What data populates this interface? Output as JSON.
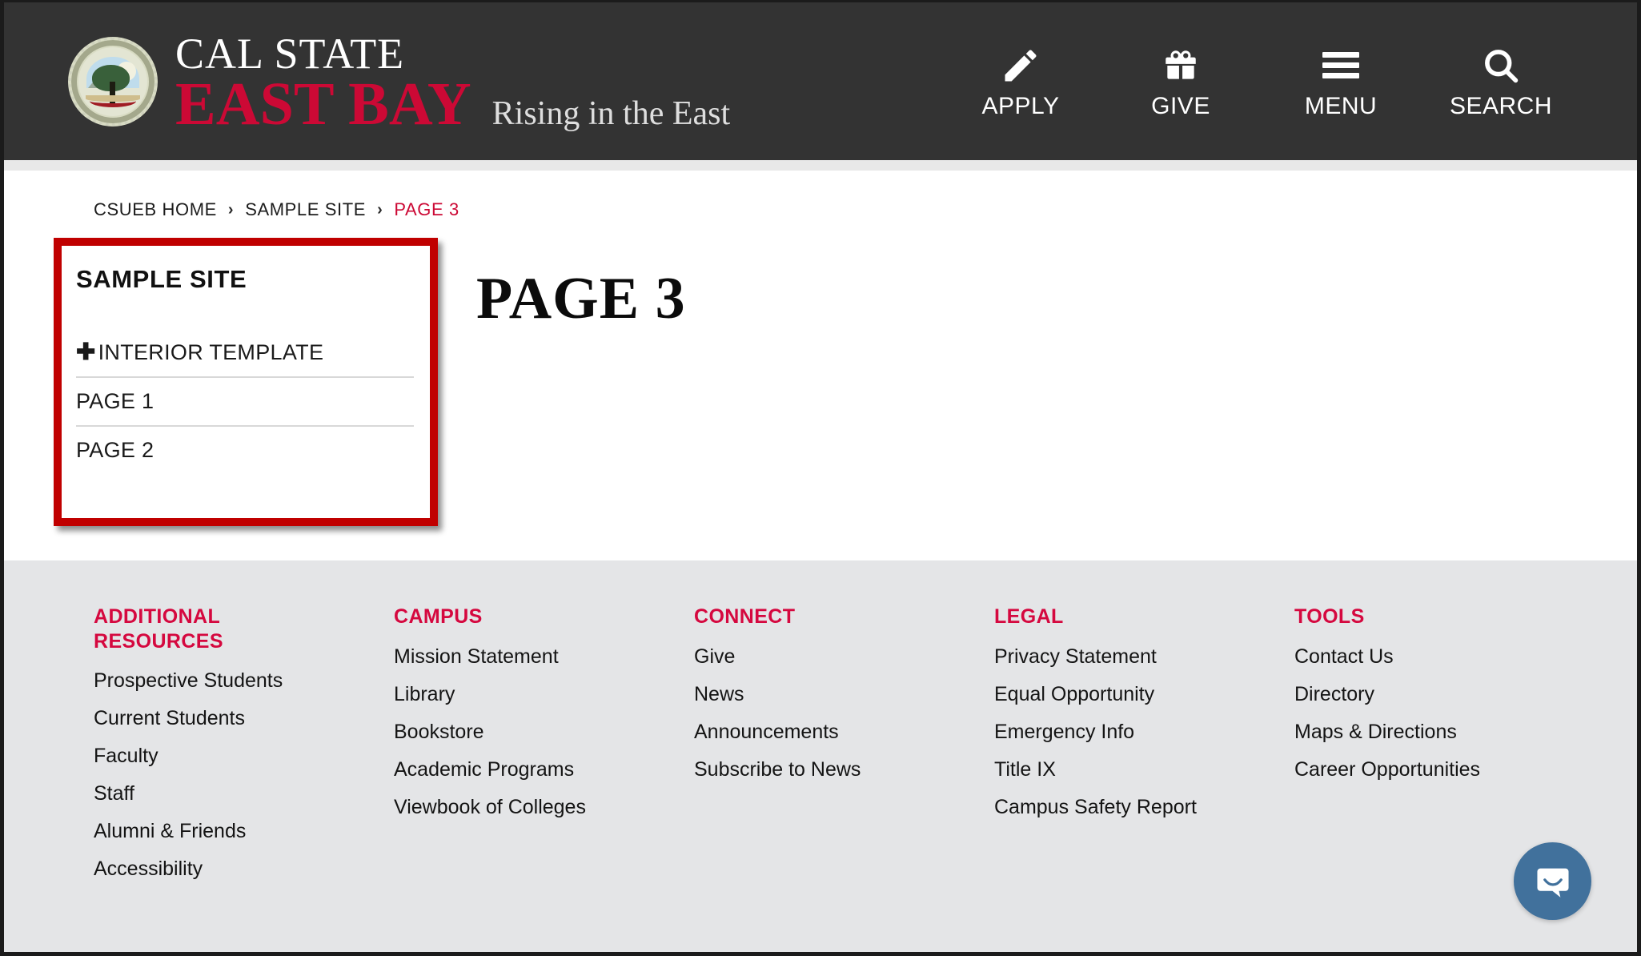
{
  "colors": {
    "header_bg": "#333333",
    "brand_red": "#cc0935",
    "footer_heading_red": "#d5083f",
    "highlight_box_red": "#c00000",
    "footer_bg": "#e4e5e7",
    "chat_blue": "#41719c"
  },
  "header": {
    "logo": {
      "seal_icon": "university-seal-icon",
      "line1": "CAL STATE",
      "line2": "EAST BAY",
      "tagline": "Rising in the East"
    },
    "nav": [
      {
        "label": "APPLY",
        "icon": "pencil-icon"
      },
      {
        "label": "GIVE",
        "icon": "gift-icon"
      },
      {
        "label": "MENU",
        "icon": "hamburger-icon"
      },
      {
        "label": "SEARCH",
        "icon": "search-icon"
      }
    ]
  },
  "breadcrumb": {
    "separator": "›",
    "items": [
      {
        "label": "CSUEB HOME",
        "current": false
      },
      {
        "label": "SAMPLE SITE",
        "current": false
      },
      {
        "label": "PAGE 3",
        "current": true
      }
    ]
  },
  "sidebar": {
    "title": "SAMPLE SITE",
    "expander_glyph": "✚",
    "items": [
      {
        "label": "INTERIOR TEMPLATE",
        "has_expander": true
      },
      {
        "label": "PAGE 1",
        "has_expander": false
      },
      {
        "label": "PAGE 2",
        "has_expander": false
      }
    ]
  },
  "main": {
    "page_title": "PAGE 3"
  },
  "footer": {
    "columns": [
      {
        "heading": "ADDITIONAL RESOURCES",
        "links": [
          "Prospective Students",
          "Current Students",
          "Faculty",
          "Staff",
          "Alumni & Friends",
          "Accessibility"
        ]
      },
      {
        "heading": "CAMPUS",
        "links": [
          "Mission Statement",
          "Library",
          "Bookstore",
          "Academic Programs",
          "Viewbook of Colleges"
        ]
      },
      {
        "heading": "CONNECT",
        "links": [
          "Give",
          "News",
          "Announcements",
          "Subscribe to News"
        ]
      },
      {
        "heading": "LEGAL",
        "links": [
          "Privacy Statement",
          "Equal Opportunity",
          "Emergency Info",
          "Title IX",
          "Campus Safety Report"
        ]
      },
      {
        "heading": "TOOLS",
        "links": [
          "Contact Us",
          "Directory",
          "Maps & Directions",
          "Career Opportunities"
        ]
      }
    ]
  },
  "chat": {
    "icon": "chat-bubble-smile-icon"
  }
}
